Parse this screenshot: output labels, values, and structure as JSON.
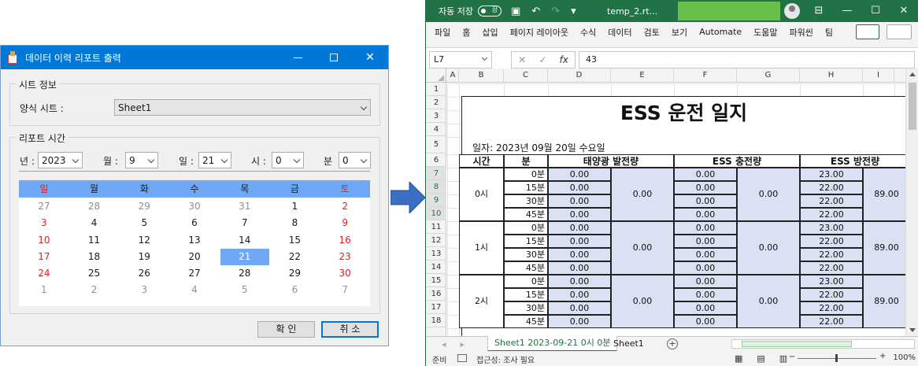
{
  "dialog": {
    "title": "데이터 이력 리포트 출력",
    "sheet_group_label": "시트 정보",
    "sheet_label": "양식 시트 :",
    "sheet_value": "Sheet1",
    "time_group_label": "리포트 시간",
    "year_label": "년 :",
    "year_value": "2023",
    "month_label": "월 :",
    "month_value": "9",
    "day_label": "일 :",
    "day_value": "21",
    "hour_label": "시 :",
    "hour_value": "0",
    "minute_label": "분",
    "minute_value": "0",
    "weekdays": [
      "일",
      "월",
      "화",
      "수",
      "목",
      "금",
      "토"
    ],
    "calendar_days": [
      [
        "27",
        "28",
        "29",
        "30",
        "31",
        "1",
        "2"
      ],
      [
        "3",
        "4",
        "5",
        "6",
        "7",
        "8",
        "9"
      ],
      [
        "10",
        "11",
        "12",
        "13",
        "14",
        "15",
        "16"
      ],
      [
        "17",
        "18",
        "19",
        "20",
        "21",
        "22",
        "23"
      ],
      [
        "24",
        "25",
        "26",
        "27",
        "28",
        "29",
        "30"
      ],
      [
        "1",
        "2",
        "3",
        "4",
        "5",
        "6",
        "7"
      ]
    ],
    "ok_label": "확 인",
    "cancel_label": "취 소"
  },
  "excel": {
    "autosave_label": "자동 저장",
    "autosave_state": "끔",
    "filename": "temp_2.rt...",
    "menu": [
      "파일",
      "홈",
      "삽입",
      "페이지 레이아웃",
      "수식",
      "데이터",
      "검토",
      "보기",
      "Automate",
      "도움말",
      "파워씬",
      "팀"
    ],
    "name_box": "L7",
    "formula_value": "43",
    "fx_label": "fx",
    "columns": [
      "A",
      "B",
      "C",
      "D",
      "E",
      "F",
      "G",
      "H",
      "I"
    ],
    "rows": [
      "1",
      "2",
      "3",
      "4",
      "5",
      "6",
      "7",
      "8",
      "9",
      "10",
      "11",
      "12",
      "13",
      "14",
      "15",
      "16",
      "17",
      "18"
    ],
    "report_title": "ESS 운전 일지",
    "report_date": "일자: 2023년 09월 20일 수요일",
    "header_time": "시간",
    "header_min": "분",
    "header_solar": "태양광 발전량",
    "header_charge": "ESS 충전량",
    "header_discharge": "ESS 방전량",
    "hours": [
      "0시",
      "1시",
      "2시"
    ],
    "minutes": [
      "0분",
      "15분",
      "30분",
      "45분"
    ],
    "solar_value": "0.00",
    "solar_total": "0.00",
    "charge_value": "0.00",
    "charge_total": "0.00",
    "discharge_values": [
      "23.00",
      "22.00",
      "22.00",
      "22.00"
    ],
    "discharge_total": "89.00",
    "tab_active": "Sheet1 2023-09-21 0시 0분",
    "tab_2": "Sheet1",
    "status_ready": "준비",
    "status_accessibility": "접근성: 조사 필요",
    "zoom": "100%"
  },
  "colors": {
    "excel_green": "#217346",
    "dialog_title_blue": "#0078d7",
    "calendar_header_blue": "#6fa8f5",
    "weekend_red": "#e02020",
    "report_fill": "#d9e1f2",
    "redacted_green": "#6abf4b"
  }
}
